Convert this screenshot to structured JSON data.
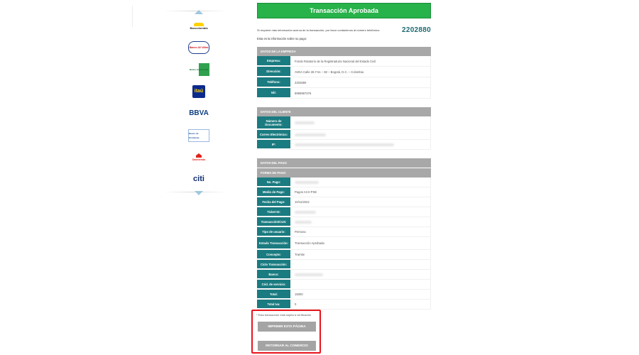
{
  "left": {
    "banks": [
      {
        "name": "Bancolombia",
        "color": "#d20f14"
      },
      {
        "name": "Banco AV Villas",
        "color": "#1c3e8c"
      },
      {
        "name": "Banco Caja Social",
        "color": "#30a14e"
      },
      {
        "name": "itaú",
        "color": "#ff8a00"
      },
      {
        "name": "BBVA",
        "color": "#0d3e80"
      },
      {
        "name": "Banco de Occidente",
        "color": "#1d4e9c"
      },
      {
        "name": "Davivienda",
        "color": "#e2231a"
      },
      {
        "name": "citi",
        "color": "#0f2c6e"
      }
    ]
  },
  "header": {
    "title": "Transacción Aprobada"
  },
  "info": {
    "text": "Si requiere más información acerca de la transacción, por favor contáctenos al número telefónico:",
    "phone": "2202880",
    "subtitle": "Esta es la información sobre su pago:"
  },
  "empresa": {
    "heading": "DATOS DE LA EMPRESA",
    "rows": [
      {
        "label": "Empresa:",
        "value": "Fondo Rotatorio de la Registraduría Nacional del Estado Civil"
      },
      {
        "label": "Dirección:",
        "value": "AVDA Calle 26 # 51 – 50 – Bogotá, D.C. – Colombia"
      },
      {
        "label": "Teléfono:",
        "value": "2202880"
      },
      {
        "label": "Nit:",
        "value": "8999997376"
      }
    ]
  },
  "cliente": {
    "heading": "DATOS DEL CLIENTE",
    "rows": [
      {
        "label": "Número de Documento:",
        "value": ""
      },
      {
        "label": "Correo Electrónico:",
        "value": ""
      },
      {
        "label": "IP:",
        "value": ""
      }
    ]
  },
  "pago": {
    "heading": "DATOS DEL PAGO",
    "subheading": "FORMA DE PAGO",
    "rows": [
      {
        "label": "No. Pago:",
        "value": ""
      },
      {
        "label": "Medio de Pago:",
        "value": "Pagos ACH PSE"
      },
      {
        "label": "Fecha del Pago:",
        "value": "10/11/2022"
      },
      {
        "label": "Ticket ID:",
        "value": ""
      },
      {
        "label": "Transacción/CUS:",
        "value": ""
      },
      {
        "label": "Tipo de usuario:",
        "value": "Persona"
      },
      {
        "label": "Estado Transacción:",
        "value": "Transacción Aprobada"
      },
      {
        "label": "Concepto:",
        "value": "Tramite"
      },
      {
        "label": "Ciclo Transacción:",
        "value": ""
      },
      {
        "label": "Banco:",
        "value": ""
      },
      {
        "label": "Cód. de servicio:",
        "value": ""
      },
      {
        "label": "Total:",
        "value": "15000"
      },
      {
        "label": "Total Iva:",
        "value": "0"
      }
    ]
  },
  "actions": {
    "note": "* Esta transacción está sujeta a verificación",
    "print_label": "IMPRIMIR ESTA PÁGINA",
    "return_label": "RETORNAR AL COMERCIO"
  }
}
